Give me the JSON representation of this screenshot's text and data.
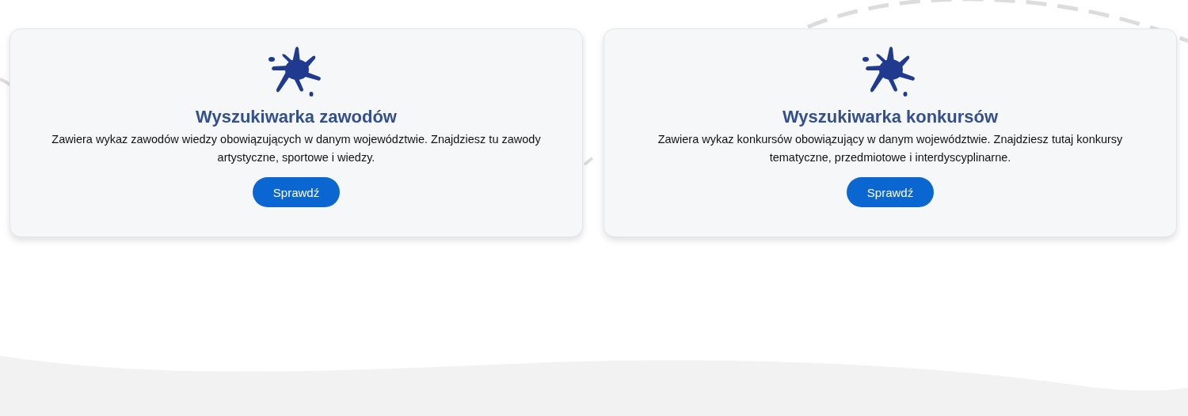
{
  "cards": [
    {
      "title": "Wyszukiwarka zawodów",
      "description": "Zawiera wykaz zawodów wiedzy obowiązujących w danym województwie. Znajdziesz tu zawody artystyczne, sportowe i wiedzy.",
      "button": "Sprawdź"
    },
    {
      "title": "Wyszukiwarka konkursów",
      "description": "Zawiera wykaz konkursów obowiązujący w danym województwie. Znajdziesz tutaj konkursy tematyczne, przedmiotowe i interdyscyplinarne.",
      "button": "Sprawdź"
    }
  ]
}
